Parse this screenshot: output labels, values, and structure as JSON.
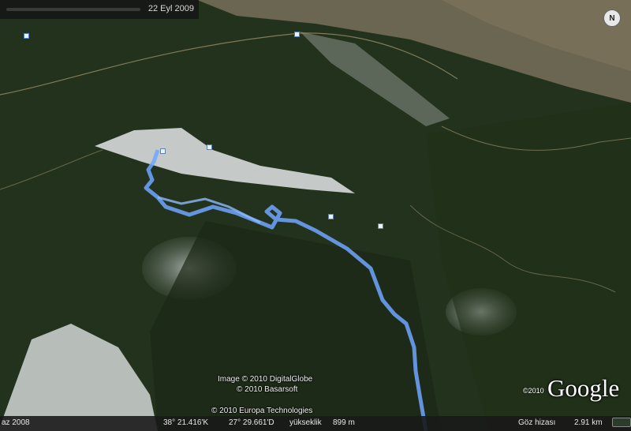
{
  "timeline": {
    "date": "22 Eyl 2009"
  },
  "compass": {
    "label": "N"
  },
  "credits": {
    "line1": "Image © 2010 DigitalGlobe",
    "line2": "© 2010 Basarsoft",
    "line3": "© 2010 Europa Technologies"
  },
  "logo": {
    "copyright": "©2010",
    "name": "Google"
  },
  "status": {
    "left_date": "az 2008",
    "lat": "38° 21.416'K",
    "lon": "27° 29.661'D",
    "elev_label": "yükseklik",
    "elev_value": "899 m",
    "eye_label": "Göz hizası",
    "eye_value": "2.91 km"
  },
  "colors": {
    "track": "#6fa6ff",
    "forest": "#24331d",
    "rock": "#b9c2c0",
    "status_bar": "#191919"
  },
  "icons": [
    "placemark-icon",
    "compass-icon",
    "eye-altitude-icon"
  ]
}
